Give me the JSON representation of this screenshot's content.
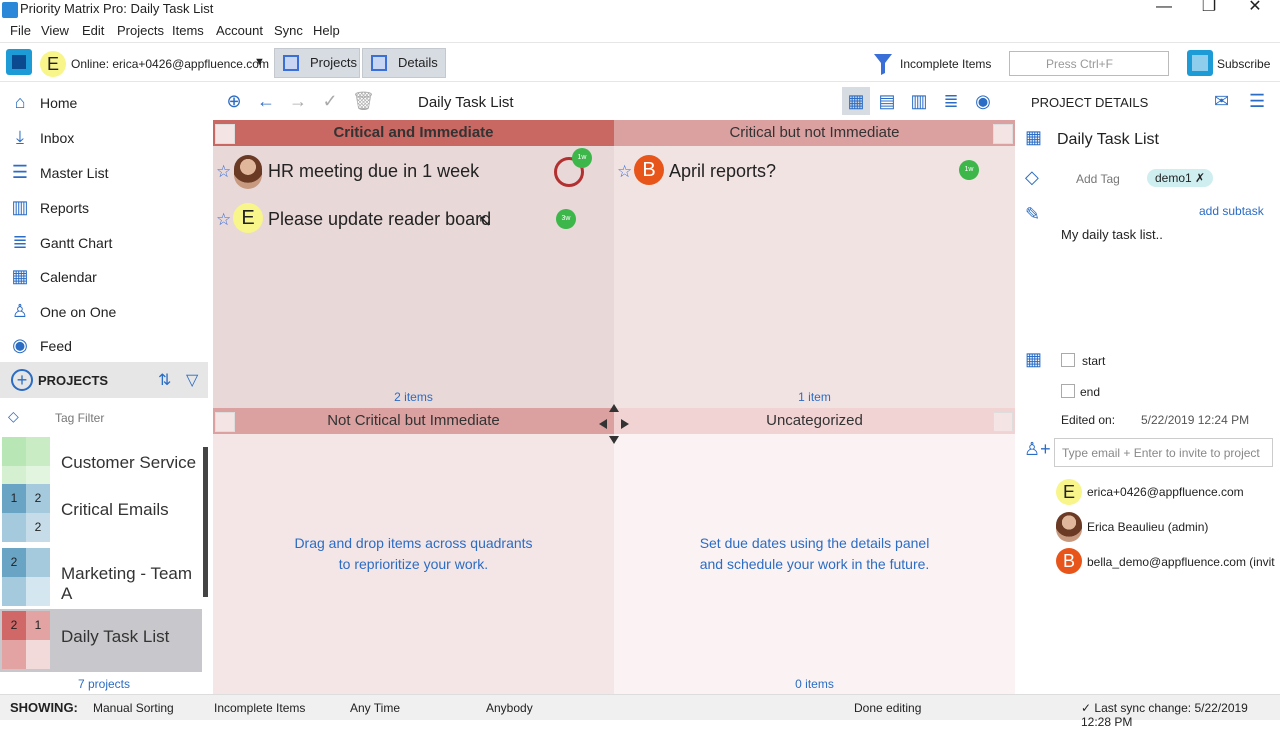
{
  "window": {
    "title": "Priority Matrix Pro: Daily Task List"
  },
  "menu": [
    "File",
    "View",
    "Edit",
    "Projects",
    "Items",
    "Account",
    "Sync",
    "Help"
  ],
  "toolbar": {
    "user_initial": "E",
    "online_label": "Online: erica+0426@appfluence.com",
    "projects_btn": "Projects",
    "details_btn": "Details",
    "filter_label": "Incomplete Items",
    "search_placeholder": "Press Ctrl+F",
    "subscribe_label": "Subscribe"
  },
  "sidebar": {
    "nav": [
      {
        "label": "Home",
        "icon": "home-icon"
      },
      {
        "label": "Inbox",
        "icon": "inbox-icon"
      },
      {
        "label": "Master List",
        "icon": "list-icon"
      },
      {
        "label": "Reports",
        "icon": "reports-icon"
      },
      {
        "label": "Gantt Chart",
        "icon": "gantt-icon"
      },
      {
        "label": "Calendar",
        "icon": "calendar-icon"
      },
      {
        "label": "One on One",
        "icon": "person-icon"
      },
      {
        "label": "Feed",
        "icon": "feed-icon"
      }
    ],
    "projects_header": "PROJECTS",
    "tag_filter": "Tag Filter",
    "projects": [
      {
        "name": "Customer Service",
        "q1": "",
        "q2": "",
        "q3": "",
        "q4": ""
      },
      {
        "name": "Critical Emails",
        "q1": "1",
        "q2": "2",
        "q3": "",
        "q4": "2"
      },
      {
        "name": "Marketing - Team A",
        "q1": "2",
        "q2": "",
        "q3": "",
        "q4": ""
      },
      {
        "name": "Daily Task List",
        "q1": "2",
        "q2": "1",
        "q3": "",
        "q4": ""
      }
    ],
    "project_count": "7 projects"
  },
  "main": {
    "title": "Daily Task List",
    "quadrants": [
      {
        "name": "Critical and Immediate",
        "count": "2 items"
      },
      {
        "name": "Critical but not Immediate",
        "count": "1 item"
      },
      {
        "name": "Not Critical but Immediate",
        "hint": [
          "Drag and drop items across quadrants",
          "to reprioritize your work."
        ]
      },
      {
        "name": "Uncategorized",
        "count": "0 items",
        "hint": [
          "Set due dates using the details panel",
          "and schedule your work in the future."
        ]
      }
    ],
    "tasks": [
      {
        "name": "HR meeting due in 1 week",
        "badge": "1w"
      },
      {
        "name": "Please update reader board",
        "avatar": "E",
        "badge": "3w"
      },
      {
        "name": "April reports?",
        "avatar": "B",
        "badge": "1w"
      }
    ]
  },
  "details": {
    "header": "PROJECT DETAILS",
    "project_name": "Daily Task List",
    "add_tag": "Add Tag",
    "tag": "demo1",
    "add_subtask": "add subtask",
    "description": "My daily task list..",
    "start_label": "start",
    "end_label": "end",
    "edited_label": "Edited on:",
    "edited_value": "5/22/2019 12:24 PM",
    "invite_placeholder": "Type email + Enter to invite to project",
    "members": [
      {
        "name": "erica+0426@appfluence.com",
        "avatar": "E"
      },
      {
        "name": "Erica Beaulieu (admin)",
        "avatar": ""
      },
      {
        "name": "bella_demo@appfluence.com (invit",
        "avatar": "B"
      }
    ]
  },
  "status": {
    "showing_label": "SHOWING:",
    "sorting": "Manual Sorting",
    "filter": "Incomplete Items",
    "time": "Any Time",
    "who": "Anybody",
    "done": "Done editing",
    "sync": "✓ Last sync change: 5/22/2019 12:28 PM"
  }
}
